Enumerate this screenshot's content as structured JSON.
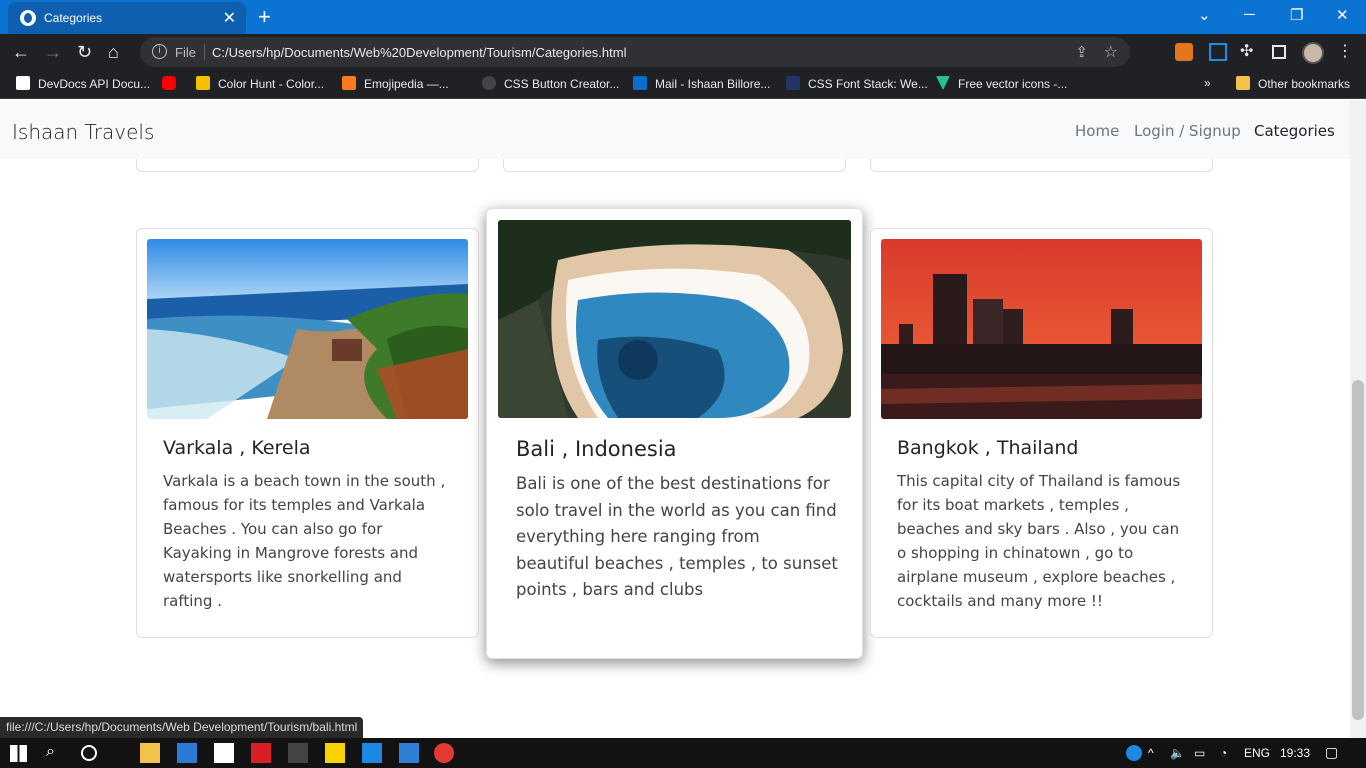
{
  "browser": {
    "tab_title": "Categories",
    "address_scheme": "File",
    "url": "C:/Users/hp/Documents/Web%20Development/Tourism/Categories.html",
    "status_url": "file:///C:/Users/hp/Documents/Web Development/Tourism/bali.html",
    "bookmarks": [
      {
        "label": "DevDocs API Docu...",
        "color": "#ffffff"
      },
      {
        "label": "",
        "color": "#ff0000"
      },
      {
        "label": "Color Hunt - Color...",
        "color": "#f2c200"
      },
      {
        "label": "Emojipedia —...",
        "color": "#ff7a1a"
      },
      {
        "label": "CSS Button Creator...",
        "color": "#555555"
      },
      {
        "label": "Mail - Ishaan Billore...",
        "color": "#0a6ed1"
      },
      {
        "label": "CSS Font Stack: We...",
        "color": "#223366"
      },
      {
        "label": "Free vector icons -...",
        "color": "#27c28c"
      }
    ],
    "other_bookmarks": "Other bookmarks"
  },
  "site": {
    "brand": "Ishaan Travels",
    "nav": [
      {
        "label": "Home",
        "active": false
      },
      {
        "label": "Login / Signup",
        "active": false
      },
      {
        "label": "Categories",
        "active": true
      }
    ]
  },
  "cards": [
    {
      "title": "Varkala , Kerela",
      "text": "Varkala is a beach town in the south , famous for its temples and Varkala Beaches . You can also go for Kayaking in Mangrove forests and watersports like snorkelling and rafting .",
      "image": "beach-cliff"
    },
    {
      "title": "Bali , Indonesia",
      "text": "Bali is one of the best destinations for solo travel in the world as you can find everything here ranging from beautiful beaches , temples , to sunset points , bars and clubs",
      "image": "aerial-cove"
    },
    {
      "title": "Bangkok , Thailand",
      "text": "This capital city of Thailand is famous for its boat markets , temples , beaches and sky bars . Also , you can o shopping in chinatown , go to airplane museum , explore beaches , cocktails and many more !!",
      "image": "city-sunset"
    }
  ],
  "taskbar": {
    "language": "ENG",
    "time": "19:33"
  }
}
